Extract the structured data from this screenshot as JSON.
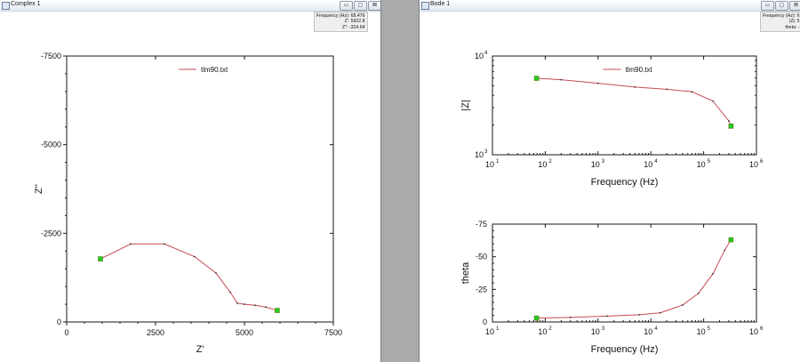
{
  "windows": [
    {
      "title": "Complex 1",
      "cursor_readout": [
        "Frequency (Hz): 68.476",
        "Z': 5922.8",
        "Z'': -324.64"
      ]
    },
    {
      "title": "Bode 1",
      "cursor_readout": [
        "Frequency (Hz): 6",
        "|Z|: 5",
        "theta: -"
      ]
    }
  ],
  "window_controls": [
    "▭",
    "▢",
    "⊠"
  ],
  "chart_data": [
    {
      "type": "scatter",
      "chart": "nyquist",
      "xlabel": "Z'",
      "ylabel": "Z''",
      "xlim": [
        0,
        7500
      ],
      "ylim": [
        0,
        -7500
      ],
      "xticks": [
        "0",
        "2500",
        "5000",
        "7500"
      ],
      "yticks": [
        "-7500",
        "-5000",
        "-2500",
        "0"
      ],
      "legend": "tlm90.txt",
      "legend_position": "top-center",
      "series_color": "#c84a55",
      "marker_color": "#22cc22",
      "x": [
        950,
        1800,
        2750,
        3600,
        4200,
        4600,
        4800,
        5000,
        5300,
        5600,
        5922.8
      ],
      "y": [
        -1780,
        -2200,
        -2200,
        -1840,
        -1380,
        -840,
        -530,
        -500,
        -470,
        -420,
        -324.64
      ]
    },
    {
      "type": "line",
      "chart": "bode-magnitude",
      "xlabel": "Frequency (Hz)",
      "ylabel": "|Z|",
      "xscale": "log",
      "yscale": "log",
      "xlim": [
        10,
        1000000
      ],
      "ylim": [
        1000,
        10000
      ],
      "xticks": [
        "10",
        "10",
        "10",
        "10",
        "10",
        "10"
      ],
      "xtick_exponents": [
        "1",
        "2",
        "3",
        "4",
        "5",
        "6"
      ],
      "yticks": [
        "10",
        "10"
      ],
      "ytick_exponents": [
        "3",
        "4"
      ],
      "legend": "tlm90.txt",
      "legend_position": "top-center",
      "series_color": "#c84a55",
      "marker_color": "#22cc22",
      "x": [
        68.476,
        200,
        1000,
        5000,
        20000,
        60000,
        150000,
        300000,
        330000
      ],
      "y": [
        5950,
        5750,
        5300,
        4850,
        4600,
        4350,
        3500,
        2200,
        1950
      ]
    },
    {
      "type": "line",
      "chart": "bode-phase",
      "xlabel": "Frequency (Hz)",
      "ylabel": "theta",
      "xscale": "log",
      "xlim": [
        10,
        1000000
      ],
      "ylim": [
        0,
        -75
      ],
      "xticks": [
        "10",
        "10",
        "10",
        "10",
        "10",
        "10"
      ],
      "xtick_exponents": [
        "1",
        "2",
        "3",
        "4",
        "5",
        "6"
      ],
      "yticks": [
        "-75",
        "-50",
        "-25",
        "0"
      ],
      "series_color": "#c84a55",
      "marker_color": "#22cc22",
      "x": [
        68.476,
        300,
        1500,
        6000,
        15000,
        40000,
        80000,
        150000,
        250000,
        330000
      ],
      "y": [
        -3,
        -3.5,
        -4.5,
        -5.5,
        -7,
        -13,
        -22,
        -37,
        -55,
        -63
      ]
    }
  ]
}
